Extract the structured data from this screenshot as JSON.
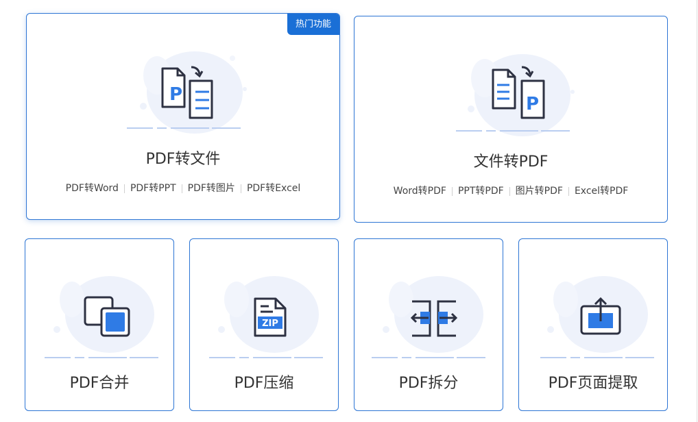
{
  "badge": {
    "hot": "热门功能"
  },
  "cards": {
    "pdf_to_file": {
      "title": "PDF转文件",
      "links": [
        "PDF转Word",
        "PDF转PPT",
        "PDF转图片",
        "PDF转Excel"
      ]
    },
    "file_to_pdf": {
      "title": "文件转PDF",
      "links": [
        "Word转PDF",
        "PPT转PDF",
        "图片转PDF",
        "Excel转PDF"
      ]
    },
    "merge": {
      "title": "PDF合并"
    },
    "compress": {
      "title": "PDF压缩",
      "icon_text": "ZIP"
    },
    "split": {
      "title": "PDF拆分"
    },
    "extract": {
      "title": "PDF页面提取"
    }
  },
  "icons": {
    "pdf_to_file": "pdf-to-word-icon",
    "file_to_pdf": "word-to-pdf-icon",
    "merge": "merge-icon",
    "compress": "zip-compress-icon",
    "split": "split-icon",
    "extract": "page-extract-icon",
    "doc_letter": "P"
  },
  "colors": {
    "border": "#2b74d4",
    "accent": "#2f7be5",
    "badge": "#1a6fd6",
    "stroke": "#2d3142",
    "blob": "#eef2fb"
  }
}
